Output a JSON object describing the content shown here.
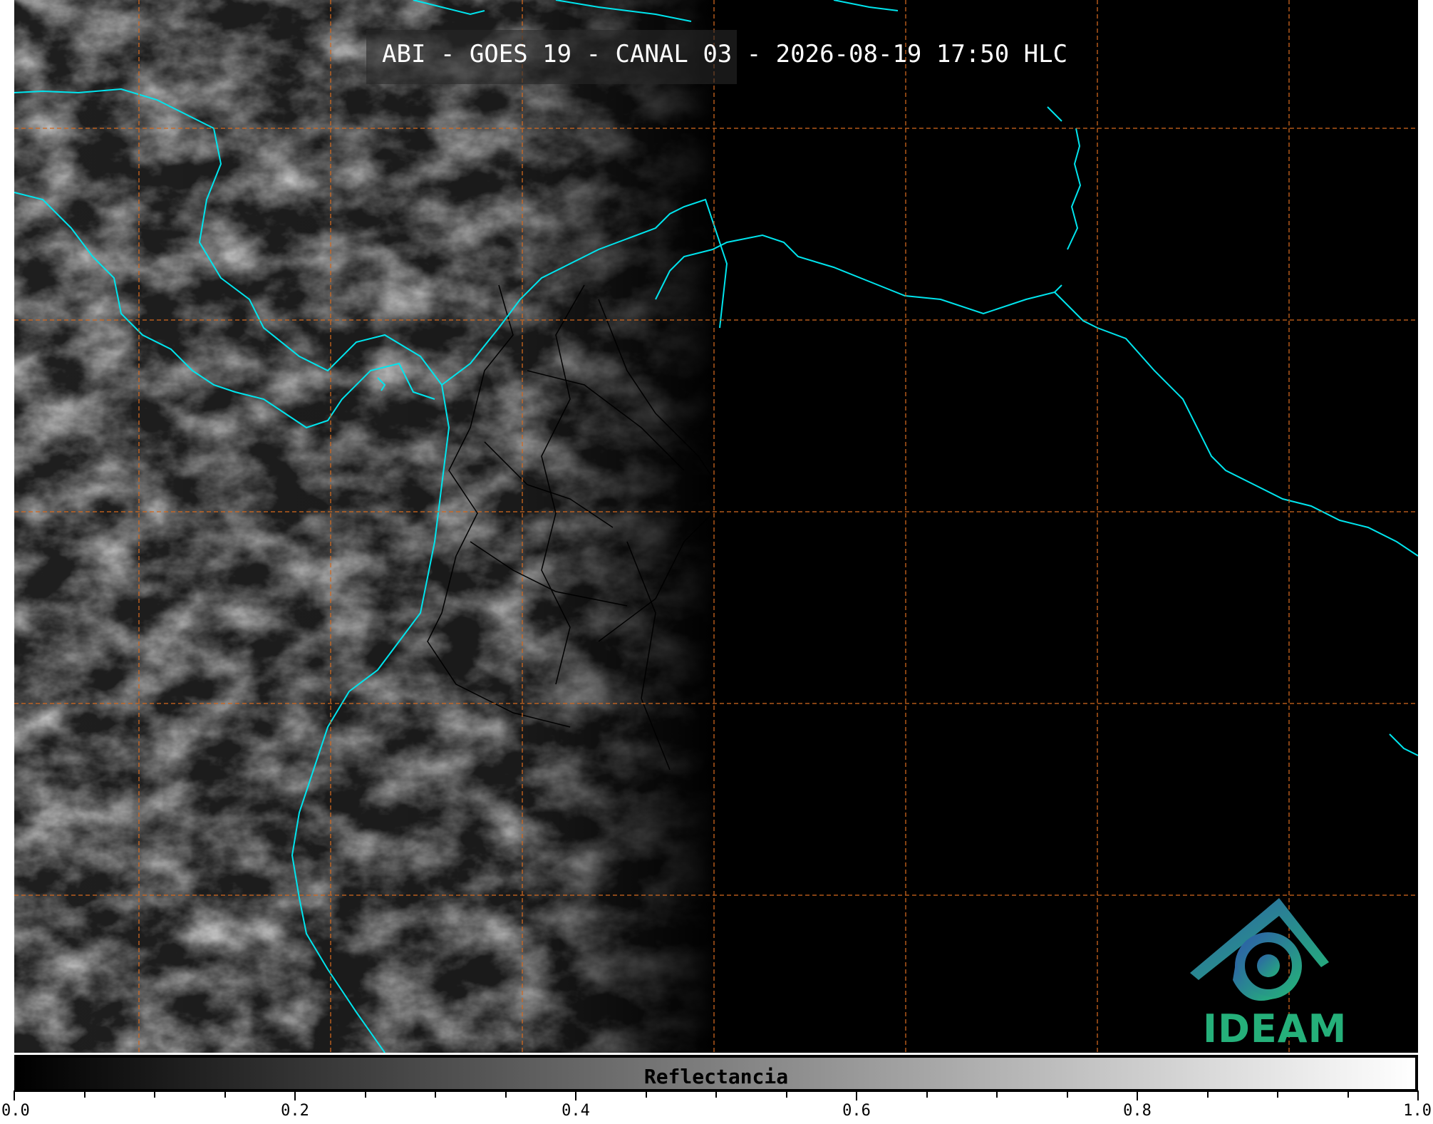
{
  "map": {
    "title": "ABI - GOES 19 - CANAL 03 - 2026-08-19 17:50 HLC",
    "colors": {
      "coastline": "#00e5ee",
      "borders": "#000000",
      "gridlines": "#d2691e",
      "logo_blue": "#2d5fa8",
      "logo_green": "#25b07a"
    },
    "logo": {
      "name": "IDEAM",
      "text": "IDEAM"
    }
  },
  "colorbar": {
    "label": "Reflectancia",
    "range": [
      0.0,
      1.0
    ],
    "major_ticks": [
      {
        "value": 0.0,
        "label": "0.0"
      },
      {
        "value": 0.2,
        "label": "0.2"
      },
      {
        "value": 0.4,
        "label": "0.4"
      },
      {
        "value": 0.6,
        "label": "0.6"
      },
      {
        "value": 0.8,
        "label": "0.8"
      },
      {
        "value": 1.0,
        "label": "1.0"
      }
    ],
    "minor_step": 0.05
  }
}
